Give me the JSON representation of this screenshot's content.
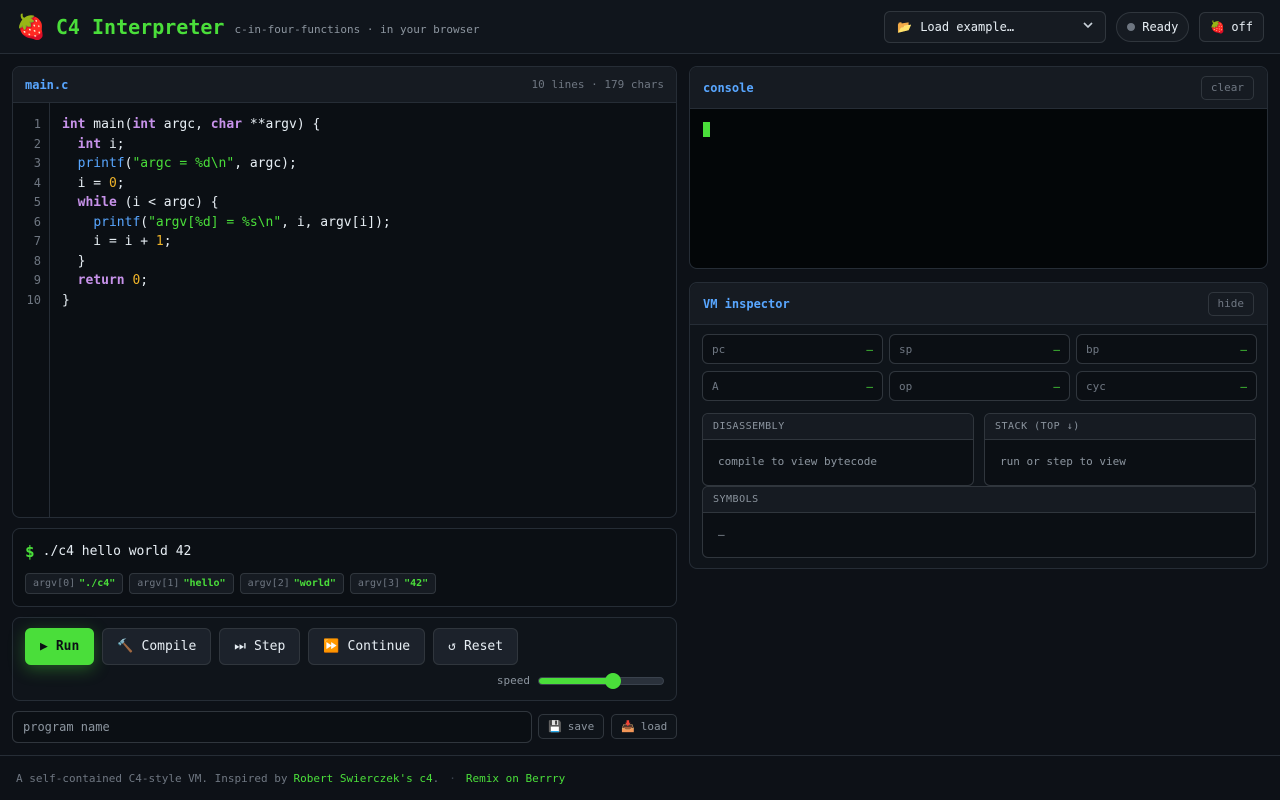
{
  "header": {
    "logo_icon": "🍓",
    "title": "C4 Interpreter",
    "subtitle": "c-in-four-functions · in your browser",
    "example_select": {
      "icon": "📂",
      "label": "Load example…"
    },
    "status": "Ready",
    "toggle": {
      "icon": "🍓",
      "label": "off"
    }
  },
  "editor": {
    "filename": "main.c",
    "meta": "10 lines · 179 chars",
    "line_numbers": [
      "1",
      "2",
      "3",
      "4",
      "5",
      "6",
      "7",
      "8",
      "9",
      "10"
    ]
  },
  "argv": {
    "prompt": "$",
    "command": "./c4 hello world 42",
    "chips": [
      {
        "key": "argv[0]",
        "value": "\"./c4\""
      },
      {
        "key": "argv[1]",
        "value": "\"hello\""
      },
      {
        "key": "argv[2]",
        "value": "\"world\""
      },
      {
        "key": "argv[3]",
        "value": "\"42\""
      }
    ]
  },
  "controls": {
    "run": {
      "icon": "▶",
      "label": "Run"
    },
    "compile": {
      "icon": "🔨",
      "label": "Compile"
    },
    "step": {
      "icon": "⏭",
      "label": "Step"
    },
    "continue": {
      "icon": "⏩",
      "label": "Continue"
    },
    "reset": {
      "icon": "↺",
      "label": "Reset"
    },
    "speed_label": "speed",
    "speed_value": 0.6
  },
  "save_row": {
    "placeholder": "program name",
    "save": {
      "icon": "💾",
      "label": "save"
    },
    "load": {
      "icon": "📥",
      "label": "load"
    }
  },
  "console": {
    "title": "console",
    "clear_label": "clear"
  },
  "inspector": {
    "title": "VM inspector",
    "hide_label": "hide",
    "registers": [
      {
        "name": "pc",
        "value": "—"
      },
      {
        "name": "sp",
        "value": "—"
      },
      {
        "name": "bp",
        "value": "—"
      },
      {
        "name": "A",
        "value": "—"
      },
      {
        "name": "op",
        "value": "—"
      },
      {
        "name": "cyc",
        "value": "—"
      }
    ],
    "disassembly": {
      "title": "DISASSEMBLY",
      "body": "compile to view bytecode"
    },
    "stack": {
      "title": "STACK (TOP ↓)",
      "body": "run or step to view"
    },
    "symbols": {
      "title": "SYMBOLS",
      "body": "—"
    }
  },
  "footer": {
    "text": "A self-contained C4-style VM. Inspired by",
    "link1": "Robert Swierczek's c4",
    "period": ".",
    "sep": "·",
    "link2": "Remix on Berrry"
  },
  "colors": {
    "accent": "#4ade3a",
    "link_blue": "#58a6ff",
    "keyword": "#c792ea",
    "number": "#f0b429"
  }
}
